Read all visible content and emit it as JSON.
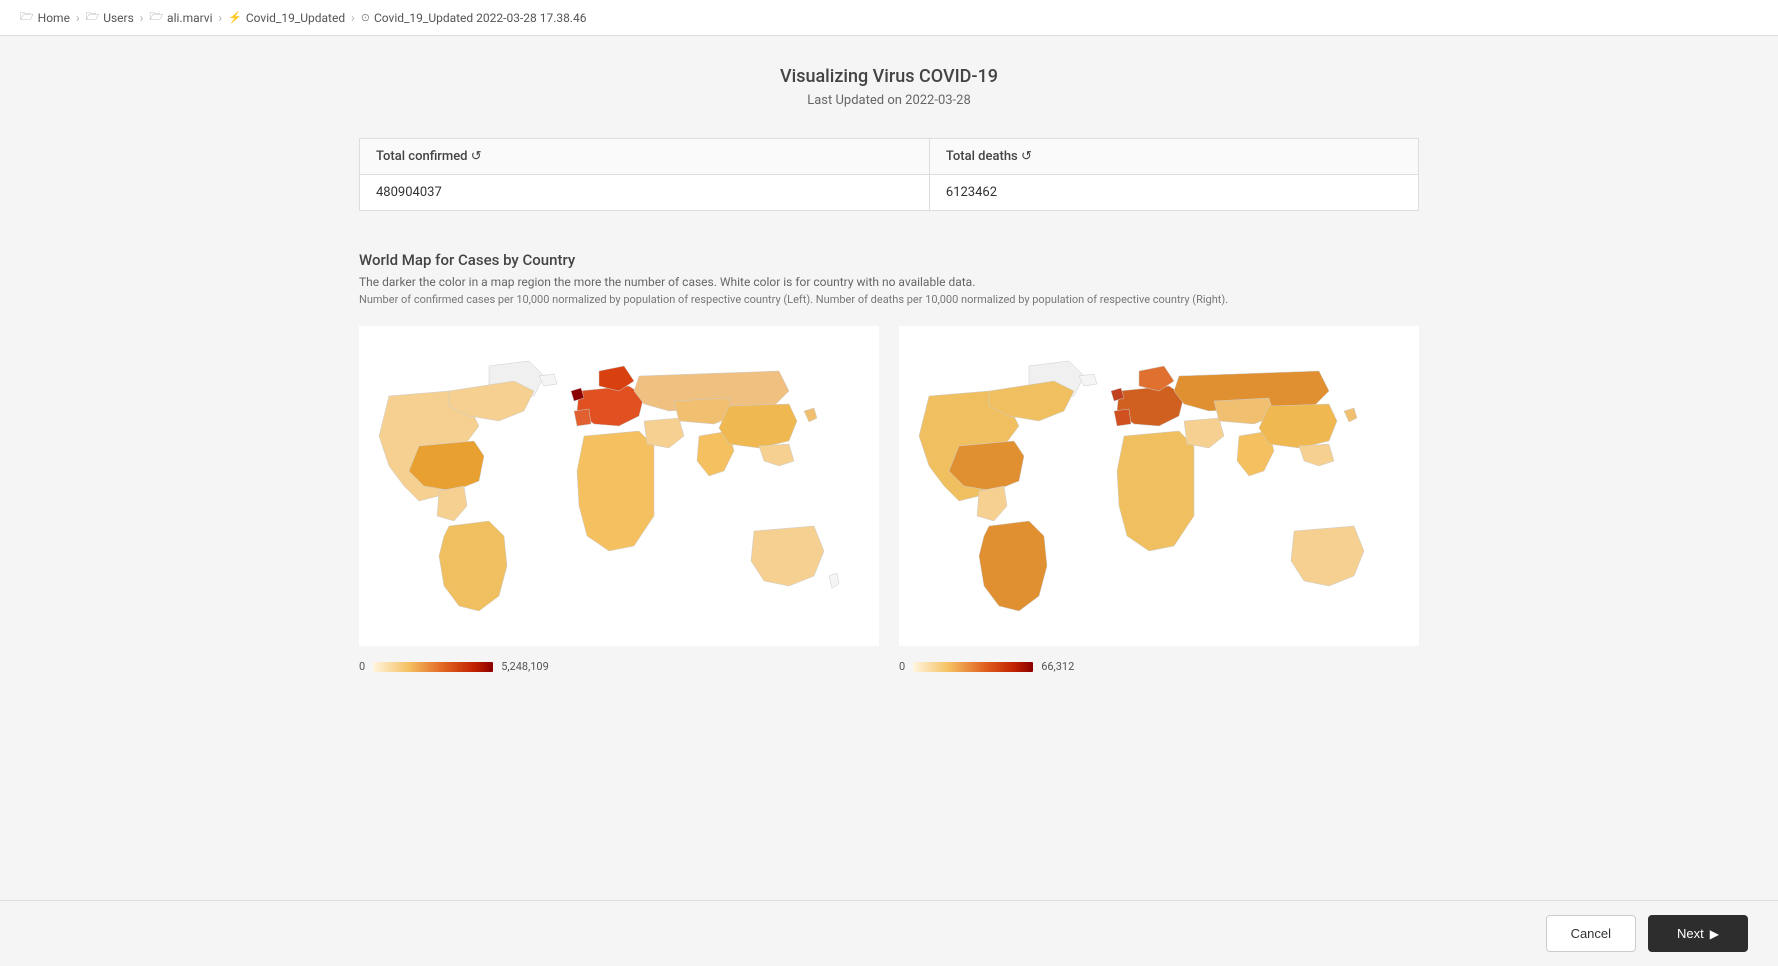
{
  "breadcrumb": {
    "items": [
      {
        "label": "Home",
        "icon": "folder-icon"
      },
      {
        "label": "Users",
        "icon": "folder-icon"
      },
      {
        "label": "ali.marvi",
        "icon": "folder-icon"
      },
      {
        "label": "Covid_19_Updated",
        "icon": "file-icon"
      },
      {
        "label": "Covid_19_Updated 2022-03-28 17.38.46",
        "icon": "clock-icon"
      }
    ],
    "separators": [
      ">",
      ">",
      ">",
      ">"
    ]
  },
  "page": {
    "title": "Visualizing Virus COVID-19",
    "subtitle": "Last Updated on 2022-03-28"
  },
  "stats": {
    "headers": [
      "Total confirmed ↺",
      "Total deaths ↺"
    ],
    "values": [
      "480904037",
      "6123462"
    ]
  },
  "map_section": {
    "title": "World Map for Cases by Country",
    "desc1": "The darker the color in a map region the more the number of cases. White color is for country with no available data.",
    "desc2": "Number of confirmed cases per 10,000 normalized by population of respective country (Left). Number of deaths per 10,000 normalized by population of respective country (Right).",
    "left_map": {
      "label_min": "0",
      "label_max": "5,248,109"
    },
    "right_map": {
      "label_min": "0",
      "label_max": "66,312"
    }
  },
  "buttons": {
    "cancel": "Cancel",
    "next": "Next"
  }
}
